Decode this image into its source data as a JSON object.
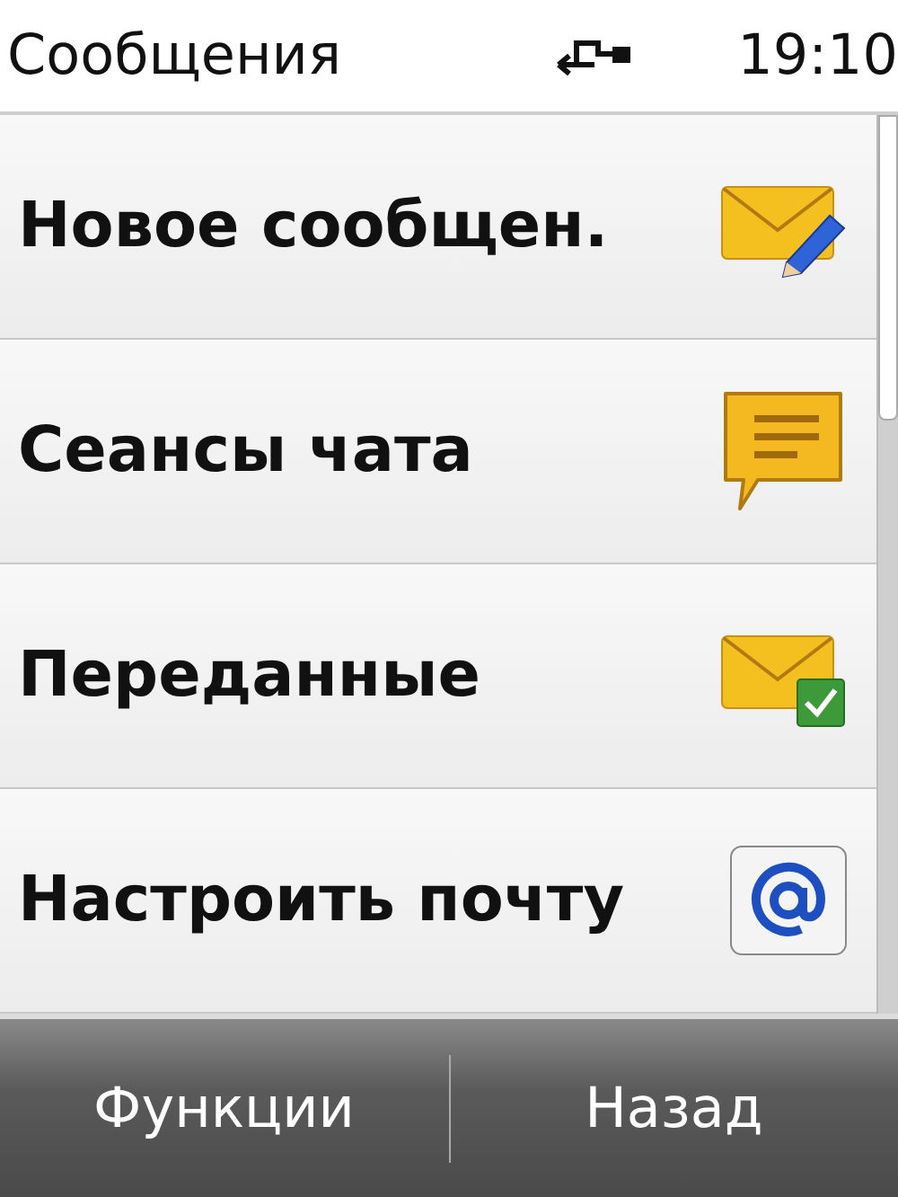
{
  "status_bar": {
    "title": "Сообщения",
    "time": "19:10"
  },
  "menu": {
    "items": [
      {
        "label": "Новое сообщен.",
        "kind": "compose"
      },
      {
        "label": "Сеансы чата",
        "kind": "chat"
      },
      {
        "label": "Переданные",
        "kind": "sent"
      },
      {
        "label": "Настроить почту",
        "kind": "mail"
      }
    ]
  },
  "softkeys": [
    "Функции",
    "Назад"
  ]
}
